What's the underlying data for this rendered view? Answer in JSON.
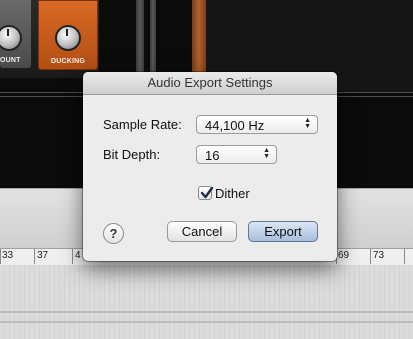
{
  "background": {
    "plugins": [
      {
        "label": "OUNT"
      },
      {
        "label": "DUCKING"
      }
    ],
    "ruler": {
      "bars": [
        "33",
        "37",
        "4",
        "69",
        "73"
      ]
    }
  },
  "dialog": {
    "title": "Audio Export Settings",
    "sample_rate": {
      "label": "Sample Rate:",
      "value": "44,100 Hz"
    },
    "bit_depth": {
      "label": "Bit Depth:",
      "value": "16"
    },
    "dither": {
      "label": "Dither",
      "checked": true
    },
    "help_label": "?",
    "cancel_label": "Cancel",
    "export_label": "Export"
  },
  "colors": {
    "plugin_orange": "#c85c1b",
    "default_button": "#a9bedc"
  }
}
